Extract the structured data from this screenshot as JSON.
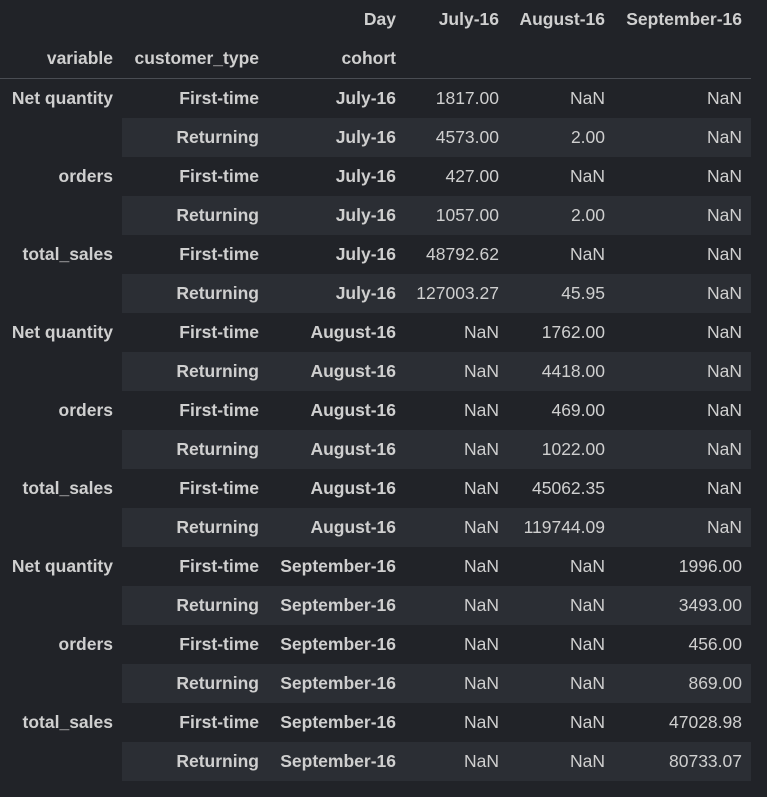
{
  "columns": {
    "index_name_top": "Day",
    "months": [
      "July-16",
      "August-16",
      "September-16"
    ],
    "index_names": [
      "variable",
      "customer_type",
      "cohort"
    ]
  },
  "rows": [
    {
      "variable": "Net quantity",
      "customer_type": "First-time",
      "cohort": "July-16",
      "values": [
        "1817.00",
        "NaN",
        "NaN"
      ]
    },
    {
      "variable": "",
      "customer_type": "Returning",
      "cohort": "July-16",
      "values": [
        "4573.00",
        "2.00",
        "NaN"
      ]
    },
    {
      "variable": "orders",
      "customer_type": "First-time",
      "cohort": "July-16",
      "values": [
        "427.00",
        "NaN",
        "NaN"
      ]
    },
    {
      "variable": "",
      "customer_type": "Returning",
      "cohort": "July-16",
      "values": [
        "1057.00",
        "2.00",
        "NaN"
      ]
    },
    {
      "variable": "total_sales",
      "customer_type": "First-time",
      "cohort": "July-16",
      "values": [
        "48792.62",
        "NaN",
        "NaN"
      ]
    },
    {
      "variable": "",
      "customer_type": "Returning",
      "cohort": "July-16",
      "values": [
        "127003.27",
        "45.95",
        "NaN"
      ]
    },
    {
      "variable": "Net quantity",
      "customer_type": "First-time",
      "cohort": "August-16",
      "values": [
        "NaN",
        "1762.00",
        "NaN"
      ]
    },
    {
      "variable": "",
      "customer_type": "Returning",
      "cohort": "August-16",
      "values": [
        "NaN",
        "4418.00",
        "NaN"
      ]
    },
    {
      "variable": "orders",
      "customer_type": "First-time",
      "cohort": "August-16",
      "values": [
        "NaN",
        "469.00",
        "NaN"
      ]
    },
    {
      "variable": "",
      "customer_type": "Returning",
      "cohort": "August-16",
      "values": [
        "NaN",
        "1022.00",
        "NaN"
      ]
    },
    {
      "variable": "total_sales",
      "customer_type": "First-time",
      "cohort": "August-16",
      "values": [
        "NaN",
        "45062.35",
        "NaN"
      ]
    },
    {
      "variable": "",
      "customer_type": "Returning",
      "cohort": "August-16",
      "values": [
        "NaN",
        "119744.09",
        "NaN"
      ]
    },
    {
      "variable": "Net quantity",
      "customer_type": "First-time",
      "cohort": "September-16",
      "values": [
        "NaN",
        "NaN",
        "1996.00"
      ]
    },
    {
      "variable": "",
      "customer_type": "Returning",
      "cohort": "September-16",
      "values": [
        "NaN",
        "NaN",
        "3493.00"
      ]
    },
    {
      "variable": "orders",
      "customer_type": "First-time",
      "cohort": "September-16",
      "values": [
        "NaN",
        "NaN",
        "456.00"
      ]
    },
    {
      "variable": "",
      "customer_type": "Returning",
      "cohort": "September-16",
      "values": [
        "NaN",
        "NaN",
        "869.00"
      ]
    },
    {
      "variable": "total_sales",
      "customer_type": "First-time",
      "cohort": "September-16",
      "values": [
        "NaN",
        "NaN",
        "47028.98"
      ]
    },
    {
      "variable": "",
      "customer_type": "Returning",
      "cohort": "September-16",
      "values": [
        "NaN",
        "NaN",
        "80733.07"
      ]
    }
  ],
  "colors": {
    "background": "#212328",
    "row_stripe": "#2b2e34",
    "text": "#cfcfcf",
    "header_rule": "#4a4d53"
  }
}
